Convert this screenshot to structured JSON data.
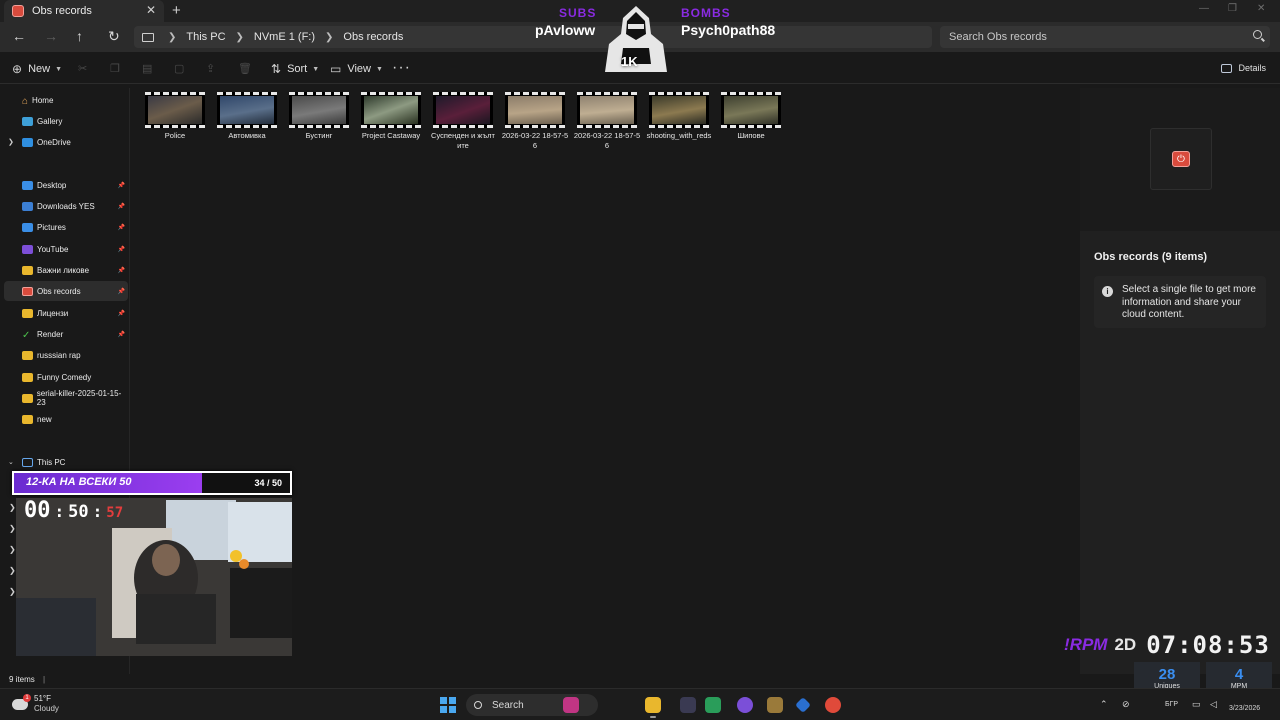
{
  "window": {
    "tab_title": "Obs records",
    "tab_close": "✕",
    "tab_new": "+",
    "controls": [
      "—",
      "❐",
      "✕"
    ]
  },
  "address": {
    "breadcrumb": [
      "This PC",
      "NVmE 1 (F:)",
      "Obs records"
    ],
    "search_placeholder": "Search Obs records"
  },
  "commands": {
    "new": "New",
    "sort": "Sort",
    "view": "View",
    "more": "···",
    "details": "Details"
  },
  "sidebar": {
    "items": [
      {
        "label": "Home",
        "icon": "home-icon"
      },
      {
        "label": "Gallery",
        "icon": "gallery-icon"
      },
      {
        "label": "OneDrive",
        "icon": "onedrive-icon"
      },
      {
        "label": "Desktop",
        "icon": "desktop-icon"
      },
      {
        "label": "Downloads YES",
        "icon": "downloads-icon"
      },
      {
        "label": "Pictures",
        "icon": "pictures-icon"
      },
      {
        "label": "YouTube",
        "icon": "folder-icon"
      },
      {
        "label": "Важни ликове",
        "icon": "folder-icon"
      },
      {
        "label": "Obs records",
        "icon": "obs-icon"
      },
      {
        "label": "Лицензи",
        "icon": "folder-icon"
      },
      {
        "label": "Render",
        "icon": "check-icon"
      },
      {
        "label": "russsian rap",
        "icon": "folder-icon"
      },
      {
        "label": "Funny Comedy",
        "icon": "folder-icon"
      },
      {
        "label": "serial-killer-2025-01-15-23",
        "icon": "folder-icon"
      },
      {
        "label": "new",
        "icon": "folder-icon"
      },
      {
        "label": "This PC",
        "icon": "this-pc-icon"
      }
    ]
  },
  "files": [
    {
      "name": "Police"
    },
    {
      "name": "Автомивка"
    },
    {
      "name": "Бустинг"
    },
    {
      "name": "Project Castaway"
    },
    {
      "name": "Суспенден и жълтите"
    },
    {
      "name": "2026-03-22 18-57-56"
    },
    {
      "name": "2026-03-22 18-57-56"
    },
    {
      "name": "shooting_with_reds"
    },
    {
      "name": "Шипове"
    }
  ],
  "details_pane": {
    "title": "Obs records (9 items)",
    "info": "Select a single file to get more information and share your cloud content."
  },
  "status": {
    "items": "9 items"
  },
  "taskbar": {
    "temp": "51°F",
    "condition": "Cloudy",
    "search": "Search",
    "lang": "БГР",
    "date": "3/23/2026"
  },
  "overlay": {
    "subs_label": "SUBS",
    "subs_name": "pAvloww",
    "bombs_label": "BOMBS",
    "bombs_name": "Psych0path88",
    "logo_text": "1K",
    "goal_label": "12-КА НА ВСЕКИ 50",
    "goal_count": "34 / 50",
    "goal_progress": 0.68,
    "timer_h": "00",
    "timer_m": "50",
    "timer_s": "57",
    "rpm_label": "!RPM",
    "rpm_mode": "2D",
    "rpm_time": "07:08:53",
    "uniques_value": "28",
    "uniques_label": "Uniques",
    "mpm_value": "4",
    "mpm_label": "MPM"
  },
  "colors": {
    "accent": "#8a2be2",
    "stat_blue": "#3a8ef0",
    "obs_red": "#d94b3d"
  }
}
